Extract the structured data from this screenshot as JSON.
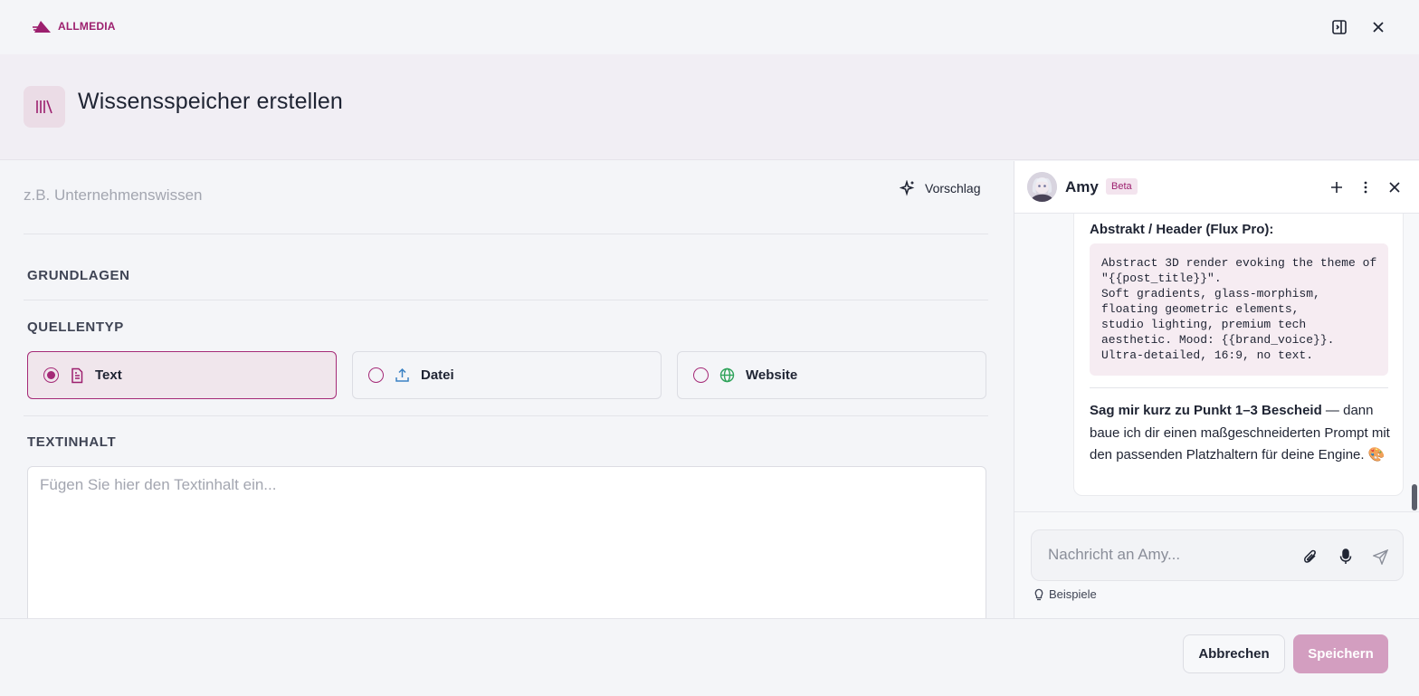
{
  "brand": {
    "name": "ALLMEDIA",
    "accent": "#a52a77"
  },
  "page": {
    "title": "Wissensspeicher erstellen",
    "header_icon": "library-icon"
  },
  "topbar": {
    "sidebar_toggle_icon": "panel-right-icon",
    "close_icon": "close-icon"
  },
  "form": {
    "name_placeholder": "z.B. Unternehmenswissen",
    "suggest_label": "Vorschlag",
    "section_basics": "GRUNDLAGEN",
    "section_source": "QUELLENTYP",
    "source_types": [
      {
        "label": "Text",
        "icon": "file-text-icon",
        "selected": true
      },
      {
        "label": "Datei",
        "icon": "upload-icon",
        "selected": false
      },
      {
        "label": "Website",
        "icon": "globe-icon",
        "selected": false
      }
    ],
    "section_content": "TEXTINHALT",
    "content_placeholder": "Fügen Sie hier den Textinhalt ein..."
  },
  "chat": {
    "assistant_name": "Amy",
    "badge": "Beta",
    "message": {
      "heading": "Abstrakt / Header (Flux Pro):",
      "code": "Abstract 3D render evoking the theme of\n\"{{post_title}}\".\nSoft gradients, glass-morphism,\nfloating geometric elements,\nstudio lighting, premium tech\naesthetic. Mood: {{brand_voice}}.\nUltra-detailed, 16:9, no text.",
      "text_bold": "Sag mir kurz zu Punkt 1–3 Bescheid",
      "text_rest": " — dann baue ich dir einen maßgeschneiderten Prompt mit den passenden Platzhaltern für deine Engine. 🎨"
    },
    "input_placeholder": "Nachricht an Amy...",
    "examples_label": "Beispiele"
  },
  "footer": {
    "cancel_label": "Abbrechen",
    "save_label": "Speichern"
  }
}
